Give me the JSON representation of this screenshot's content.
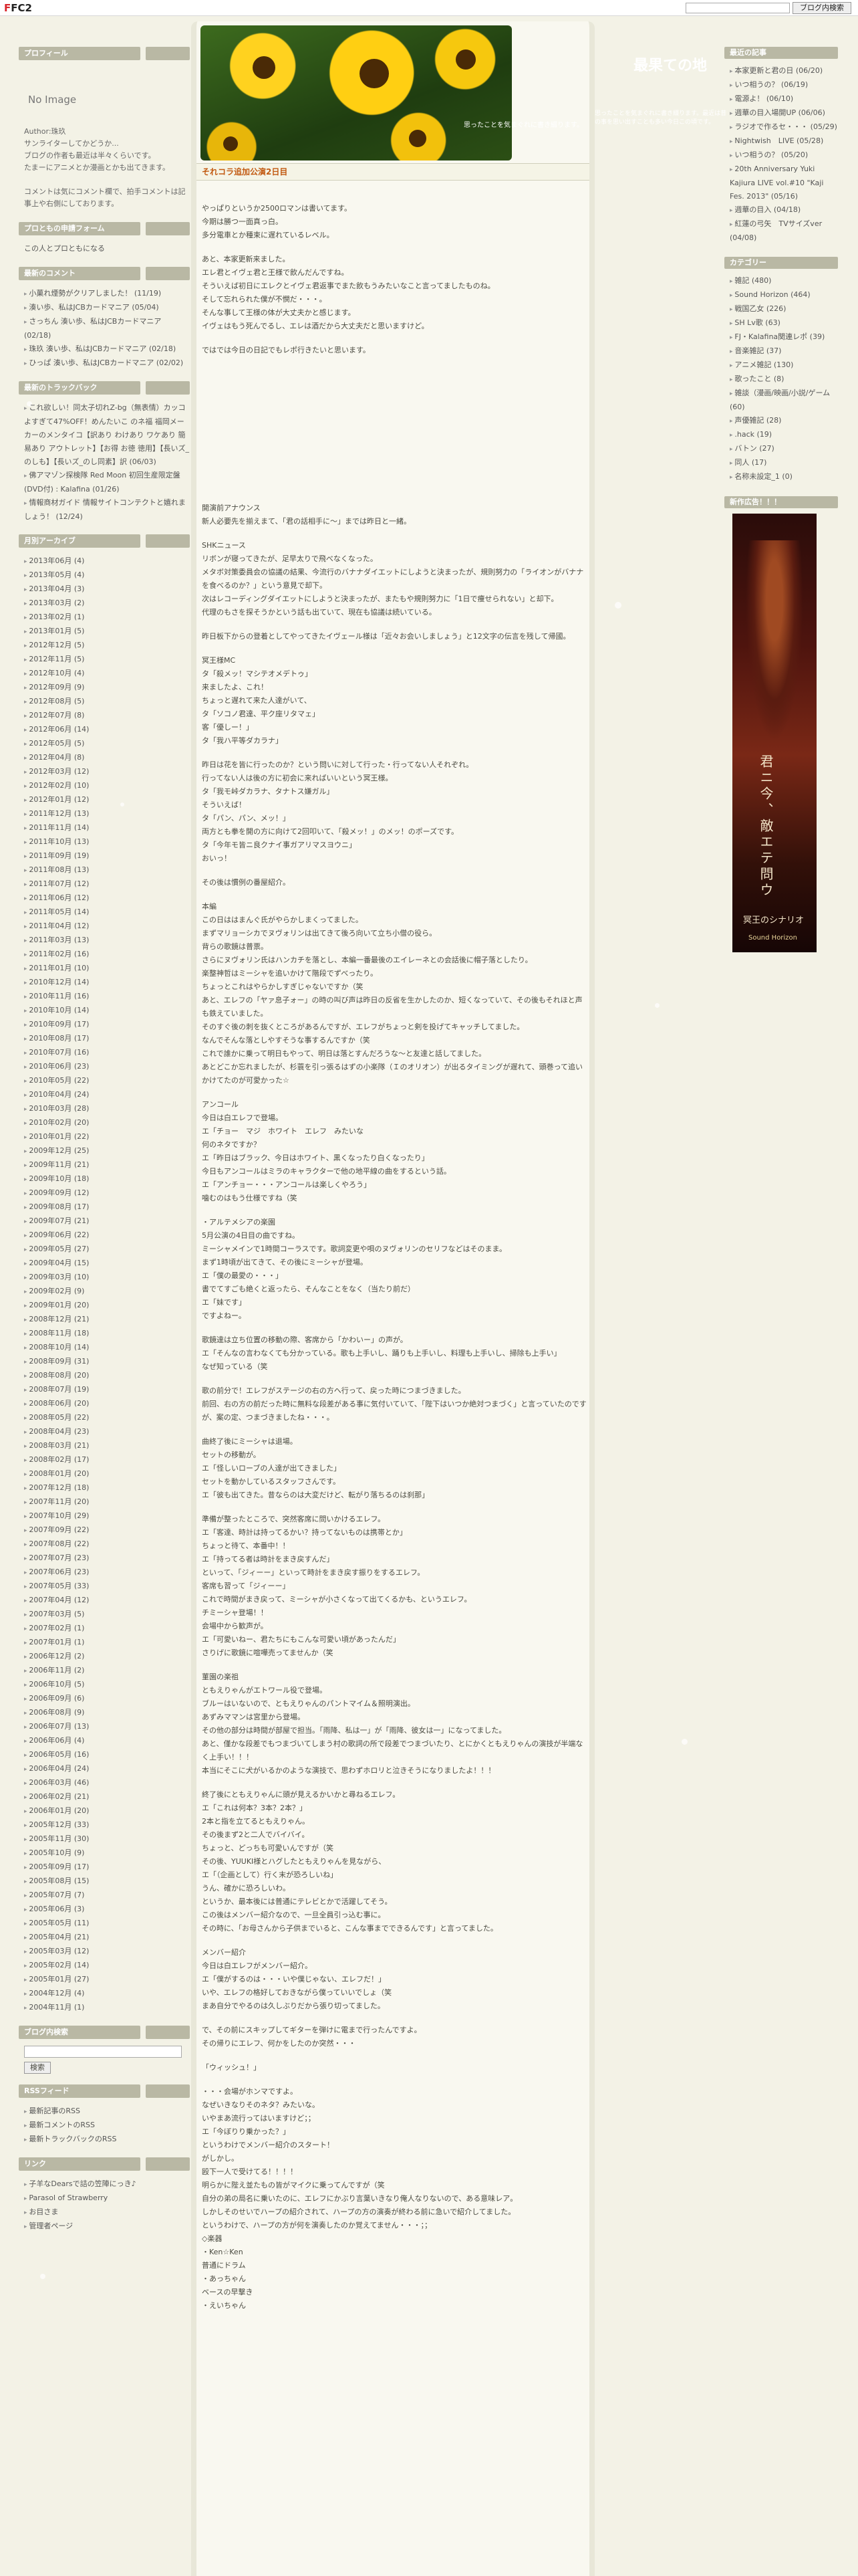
{
  "topbar": {
    "logo_prefix": "F",
    "logo_main": "FC2",
    "search_placeholder": "",
    "search_button": "ブログ内検索"
  },
  "site": {
    "title": "最果ての地",
    "description": "思ったことを気まぐれに書き綴ります。最近は昔の事を思い出すことも多い今日この頃です。"
  },
  "header": {
    "caption": "思ったことを気まぐれに書き綴ります。",
    "sub": "最近は昔の事を思い出すことも多い今日この頃です。"
  },
  "left": {
    "profile": {
      "heading": "プロフィール",
      "noimage": "No Image",
      "text1": "Author:珠玖\nサンライターしてかどうか...\nブログの作者も最近は半々くらいです。\nたまーにアニメとか漫画とかも出てきます。",
      "text2": "コメントは気にコメント欄で、拍手コメントは記事上や右側にしております。"
    },
    "form": {
      "heading": "プロともの申請フォーム",
      "item": "この人とプロともになる"
    },
    "comments": {
      "heading": "最新のコメント",
      "items": [
        "小菓れ煙勢がクリアしました！ (11/19)",
        "湊い歩、私はJCBカードマニア (05/04)",
        "さっちん 湊い歩、私はJCBカードマニア (02/18)",
        "珠玖 湊い歩、私はJCBカードマニア (02/18)",
        "ひっぱ 湊い歩、私はJCBカードマニア (02/02)"
      ]
    },
    "trackback": {
      "heading": "最新のトラックバック",
      "items": [
        "これ欲しい！同太子切れZ-bg（無表情）カッコよすぎて47%OFF！めんたいこ のネ福 福岡メーカーのメンタイコ【訳あり わけあり ワケあり 簡易あり アウトレット】【お得 お徳 徳用】【長いズ_のしも】【長いズ_のし同素】訳 (06/03)",
        "佛アマゾン探検隊 Red Moon 初回生産限定盤 (DVD付) : Kalafina (01/26)",
        "情報商材ガイド 情報サイトコンテクトと嬉れましょう！ (12/24)"
      ]
    },
    "archive": {
      "heading": "月別アーカイブ",
      "items": [
        "2013年06月 (4)",
        "2013年05月 (4)",
        "2013年04月 (3)",
        "2013年03月 (2)",
        "2013年02月 (1)",
        "2013年01月 (5)",
        "2012年12月 (5)",
        "2012年11月 (5)",
        "2012年10月 (4)",
        "2012年09月 (9)",
        "2012年08月 (5)",
        "2012年07月 (8)",
        "2012年06月 (14)",
        "2012年05月 (5)",
        "2012年04月 (8)",
        "2012年03月 (12)",
        "2012年02月 (10)",
        "2012年01月 (12)",
        "2011年12月 (13)",
        "2011年11月 (14)",
        "2011年10月 (13)",
        "2011年09月 (19)",
        "2011年08月 (13)",
        "2011年07月 (12)",
        "2011年06月 (12)",
        "2011年05月 (14)",
        "2011年04月 (12)",
        "2011年03月 (13)",
        "2011年02月 (16)",
        "2011年01月 (10)",
        "2010年12月 (14)",
        "2010年11月 (16)",
        "2010年10月 (14)",
        "2010年09月 (17)",
        "2010年08月 (17)",
        "2010年07月 (16)",
        "2010年06月 (23)",
        "2010年05月 (22)",
        "2010年04月 (24)",
        "2010年03月 (28)",
        "2010年02月 (20)",
        "2010年01月 (22)",
        "2009年12月 (25)",
        "2009年11月 (21)",
        "2009年10月 (18)",
        "2009年09月 (12)",
        "2009年08月 (17)",
        "2009年07月 (21)",
        "2009年06月 (22)",
        "2009年05月 (27)",
        "2009年04月 (15)",
        "2009年03月 (10)",
        "2009年02月 (9)",
        "2009年01月 (20)",
        "2008年12月 (21)",
        "2008年11月 (18)",
        "2008年10月 (14)",
        "2008年09月 (31)",
        "2008年08月 (20)",
        "2008年07月 (19)",
        "2008年06月 (20)",
        "2008年05月 (22)",
        "2008年04月 (23)",
        "2008年03月 (21)",
        "2008年02月 (17)",
        "2008年01月 (20)",
        "2007年12月 (18)",
        "2007年11月 (20)",
        "2007年10月 (29)",
        "2007年09月 (22)",
        "2007年08月 (22)",
        "2007年07月 (23)",
        "2007年06月 (23)",
        "2007年05月 (33)",
        "2007年04月 (12)",
        "2007年03月 (5)",
        "2007年02月 (1)",
        "2007年01月 (1)",
        "2006年12月 (2)",
        "2006年11月 (2)",
        "2006年10月 (5)",
        "2006年09月 (6)",
        "2006年08月 (9)",
        "2006年07月 (13)",
        "2006年06月 (4)",
        "2006年05月 (16)",
        "2006年04月 (24)",
        "2006年03月 (46)",
        "2006年02月 (21)",
        "2006年01月 (20)",
        "2005年12月 (33)",
        "2005年11月 (30)",
        "2005年10月 (9)",
        "2005年09月 (17)",
        "2005年08月 (15)",
        "2005年07月 (7)",
        "2005年06月 (3)",
        "2005年05月 (11)",
        "2005年04月 (21)",
        "2005年03月 (12)",
        "2005年02月 (14)",
        "2005年01月 (27)",
        "2004年12月 (4)",
        "2004年11月 (1)"
      ]
    },
    "blogsearch": {
      "heading": "ブログ内検索",
      "button": "検索"
    },
    "rss": {
      "heading": "RSSフィード",
      "items": [
        "最新記事のRSS",
        "最新コメントのRSS",
        "最新トラックバックのRSS"
      ]
    },
    "links": {
      "heading": "リンク",
      "items": [
        "子羊なDearsで詰の笠陣にっき♪",
        "Parasol of Strawberry",
        "お目さま",
        "管理者ページ"
      ]
    }
  },
  "entry": {
    "title": "それコラ追加公演2日目",
    "paragraphs": [
      "やっぱりというか2500ロマンは書いてます。\n今期は勝つ一面真っ白。\n多分電車とか種束に遅れているレベル。",
      "あと、本家更新来ました。\nエレ君とイヴェ君と王様で飲んだんですね。\nそういえば初日にエレクとイヴェ君返事でまた飲もうみたいなこと言ってましたものね。\nそして忘れられた僕が不憫だ・・・。\nそんな事して王様の体が大丈夫かと感じます。\nイヴェはもう死んでるし、エレは酒だから大丈夫だと思いますけど。",
      "ではでは今日の日記でもレポ行きたいと思います。"
    ],
    "body2": [
      "開演前アナウンス\n新人必要先を揃えまて、「君の話相手に～」までは昨日と一緒。",
      "SHKニュース\nリボンが寝ってきたが、足早太りで飛べなくなった。\nメタボ対策委員会の協議の結果、今流行のバナナダイエットにしようと決まったが、規則努力の「ライオンがバナナを食べるのか？」という意見で却下。\n次はレコーディングダイエットにしようと決まったが、またもや規則努力に「1日で痩せられない」と却下。\n代理のもさを探そうかという話も出ていて、現在も協議は続いている。",
      "昨日板下からの登着としてやってきたイヴェール様は「近々お会いしましょう」と12文字の伝言を残して帰國。",
      "冥王様MC\nタ「殺メッ！マシテオメデトゥ」\n来ましたよ、これ！\nちょっと遅れて来た人達がいて、\nタ「ソコノ君達、平ク座リタマェ」\n客「優しー！」\nタ「我ハ平等ダカラナ」",
      "昨日は花を皆に行ったのか？という問いに対して行った・行ってない人それぞれ。\n行ってない人は後の方に初会に来ればいいという冥王様。\nタ「我モ峠ダカラナ、タナトス嫌ガル」\nそういえば！\nタ「パン、パン、メッ！」\n両方とも拳を開の方に向けて2回叩いて、「殺メッ！」のメッ！のポーズです。\nタ「今年モ皆ニ良クナイ事ガアリマスヨウニ」\nおいっ！",
      "その後は慣例の番屋紹介。",
      "本編\nこの日ははまんぐ氏がやらかしまくってました。\nまずマリョーシカでヌヴォリンは出てきて後ろ向いて立ち小僧の役ら。\n背らの歌鏡は普票。\nさらにヌヴォリン氏はハンカチを落とし、本編一番最後のエイレーネとの会話後に帽子落としたり。\n楽整神哲はミーシャを追いかけて階段でずべったり。\nちょっとこれはやらかしすぎじゃないですか（笑\nあと、エレフの「ヤァ息子ォー」の時の叫び声は昨日の反省を生かしたのか、短くなっていて、その後もそれほと声も鉄えていました。\nそのすぐ後の刺を抜くところがあるんですが、エレフがちょっと剣を投げてキャッチしてました。\nなんでそんな落としやすそうな事するんですか（笑\nこれで誰かに乗って明日もやって、明日は落とすんだろうな～と友達と話してました。\nあとどこか忘れましたが、杉蓑を引っ張るはずの小楽隊（Ｉのオリオン）が出るタイミングが遅れて、頭巻って追いかけてたのが可愛かった☆",
      "アンコール\n今日は白エレフで登場。\nエ「チョー　マジ　ホワイト　エレフ　みたいな\n何のネタですか？\nエ「昨日はブラック、今日はホワイト、黒くなったり白くなったり」\n今日もアンコールはミラのキャラクターで他の地平線の曲をするという話。\nエ「アンチョー・・・アンコールは楽しくやろう」\n噛むのはもう仕様ですね（笑",
      "・アルテメシアの楽園\n5月公演の4日目の曲ですね。\nミーシャメインで1時間コーラスです。歌詞変更や唄のヌヴォリンのセリフなどはそのまま。\nまず1時頃が出てきて、その後にミーシャが登場。\nエ「僕の最愛の・・・」\n書でてすごも絶くと返ったら、そんなことをなく（当たり前だ）\nエ「妹です」\nですよねー。",
      "歌鏡達は立ち位置の移動の際、客席から「かわいー」の声が。\nエ「そんなの言わなくても分かっている。歌も上手いし、踊りも上手いし、料理も上手いし、掃除も上手い」\nなぜ知っている（笑",
      "歌の前分で！エレフがステージの右の方へ行って、戻った時につまづきました。\n前回、右の方の前だった時に無料な段差がある事に気付いていて、「陛下はいつか絶対つまづく」と言っていたのですが、案の定、つまづきましたね・・・。",
      "曲終了後にミーシャは退場。\nセットの移動が。\nエ「怪しいローブの人達が出てきました」\nセットを動かしているスタッフさんです。\nエ「彼も出てきた。昔ならのは大変だけど、転がり落ちるのは刹那」",
      "準備が整ったところで、突然客席に問いかけるエレフ。\nエ「客達、時計は持ってるかい？持ってないものは携帯とか」\nちょっと待て、本番中！！\nエ「持ってる者は時計をまき戻すんだ」\nといって、「ジィーー」といって時計をまき戻す振りをするエレフ。\n客席も習って「ジィーー」\nこれで時間がまき戻って、ミーシャが小さくなって出てくるかも、というエレフ。\nチミーシャ登場！！\n会場中から歓声が。\nエ「可愛いねー、君たちにもこんな可愛い頃があったんだ」\nさりげに歌鏡に喧嘩売ってませんか（笑",
      "菫園の楽祖\nともえりゃんがエトワール役で登場。\nブルーはいないので、ともえりゃんのパントマイム＆照明演出。\nあずみママンは宮里から登場。\nその他の部分は時間が部屋で担当。「雨降、私は一」が「雨降、彼女は一」になってました。\nあと、僅かな段差でもつまづいてしまう村の歌詞の所で段差でつまづいたり、とにかくともえりゃんの演技が半端なく上手い！！！\n本当にそこに犬がいるかのような演技で、思わずホロリと泣きそうになりましたよ！！！",
      "終了後にともえりゃんに頭が見えるかいかと尋ねるエレフ。\nエ「これは何本？3本？2本？」\n2本と指を立てるともえりゃん。\nその後まず2と二人でバイバイ。\nちょっと、どっちも可愛いんですが（笑\nその後、YUUKI様とハグしたともえりゃんを見ながら、\nエ「（企画として）行く末が恐ろしいね」\nうん、確かに恐ろしいわ。\nというか、最本後には普通にテレビとかで活躍してそう。\nこの後はメンバー紹介なので、一旦全員引っ込む事に。\nその時に、「お母さんから子供までいると、こんな事までできるんです」と言ってました。",
      "メンバー紹介\n今日は白エレフがメンバー紹介。\nエ「僕がするのは・・・いや僕じゃない、エレフだ！」\nいや、エレフの格好しておきながら僕っていいでしょ（笑\nまあ自分でやるのは久しぶりだから張り切ってました。",
      "で、その前にスキップしてギターを弾けに電まで行ったんですよ。\nその帰りにエレフ、何かをしたのか突然・・・",
      "「ウィッシュ！」",
      "・・・会場がホンマですよ。\nなぜいきなりそのネタ？みたいな。\nいやまあ流行ってはいますけど；；\nエ「今ぼりり乗かった？」\nというわけでメンバー紹介のスタート！\nがしかし。\n殴下一人で受けてる！！！！\n明らかに陛え並たもの皆がマイクに乗ってんですが（笑\n自分の弟の局名に乗いたのに、エレフにかぶり言葉いきなり俺人なりないので、ある意味レア。\nしかしそのせいでハープの紹介されて、ハープの方の演奏が終わる前に急いで紹介してました。\nというわけで、ハープの方が何を演奏したのか覚えてません・・・；；\n◇楽器\n・Ken☆Ken\n普通にドラム\n・あっちゃん\nベースの早撃き\n・えいちゃん"
    ]
  },
  "right": {
    "recent": {
      "heading": "最近の記事",
      "items": [
        "本家更新と君の日 (06/20)",
        "いつ相うの？ (06/19)",
        "電源よ！ (06/10)",
        "週華の目入場開UP (06/06)",
        "ラジオで作るセ・・・ (05/29)",
        "Nightwish　LIVE (05/28)",
        "いつ相うの？ (05/20)",
        "20th Anniversary Yuki Kajiura LIVE vol.#10 \"Kaji Fes. 2013\" (05/16)",
        "週華の目入 (04/18)",
        "紅蓮の弓矢　TVサイズver (04/08)"
      ]
    },
    "category": {
      "heading": "カテゴリー",
      "items": [
        "雑記 (480)",
        "Sound Horizon (464)",
        "戦国乙女 (226)",
        "SH Lv歌 (63)",
        "FJ・Kalafina関連レポ (39)",
        "音楽雑記 (37)",
        "アニメ雑記 (130)",
        "歌ったこと (8)",
        "雑談（漫画/映画/小説/ゲーム (60)",
        "声優雑記 (28)",
        ".hack (19)",
        "バトン (27)",
        "同人 (17)",
        "名称未設定_1 (0)"
      ]
    },
    "ad": {
      "heading": "新作広告！！！",
      "text1": "君ニ今、敵エテ問ウ",
      "text2": "冥王のシナリオ",
      "text3": "Sound Horizon"
    }
  }
}
